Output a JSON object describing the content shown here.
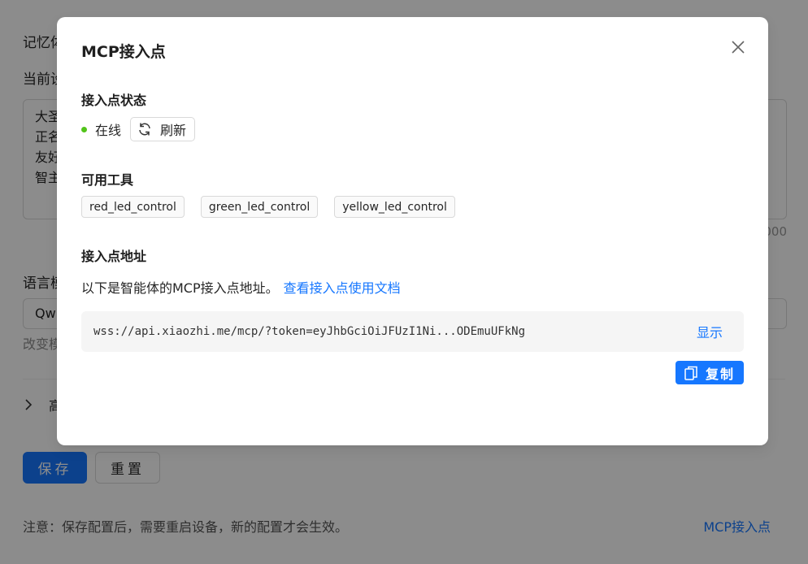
{
  "background": {
    "memory_label": "记忆体",
    "current_label": "当前设",
    "textarea_lines": [
      "大圣",
      "正名",
      "友好",
      "智主"
    ],
    "counter": "000",
    "language_label": "语言模",
    "select_value": "Qw",
    "hint": "改变模",
    "advanced_label": "高",
    "save_button": "保存",
    "reset_button": "重置",
    "note": "注意：保存配置后，需要重启设备，新的配置才会生效。",
    "mcp_link": "MCP接入点"
  },
  "modal": {
    "title": "MCP接入点",
    "status_section": {
      "title": "接入点状态",
      "status": "在线",
      "status_color": "#52c41a",
      "refresh_label": "刷新"
    },
    "tools_section": {
      "title": "可用工具",
      "tools": [
        "red_led_control",
        "green_led_control",
        "yellow_led_control"
      ]
    },
    "address_section": {
      "title": "接入点地址",
      "description": "以下是智能体的MCP接入点地址。",
      "doc_link": "查看接入点使用文档",
      "url": "wss://api.xiaozhi.me/mcp/?token=eyJhbGciOiJFUzI1Ni...ODEmuUFkNg",
      "show_label": "显示",
      "copy_label": "复制"
    }
  },
  "colors": {
    "primary": "#1677ff",
    "mask": "rgba(0,0,0,0.45)"
  }
}
